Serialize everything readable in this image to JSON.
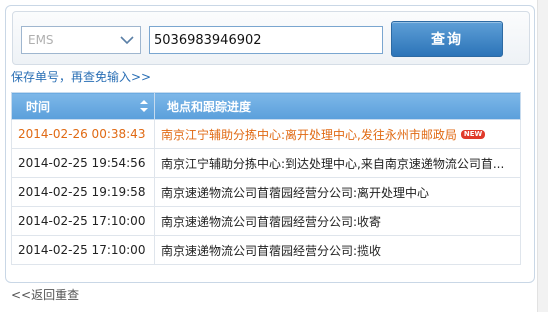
{
  "search": {
    "carrier_selected": "EMS",
    "tracking_number": "5036983946902",
    "query_label": "查询"
  },
  "save_link": "保存单号，再查免输入>>",
  "table": {
    "headers": {
      "time": "时间",
      "location": "地点和跟踪进度"
    },
    "rows": [
      {
        "time": "2014-02-26 00:38:43",
        "status": "南京江宁辅助分拣中心:离开处理中心,发往永州市邮政局",
        "latest": true,
        "badge": "NEW"
      },
      {
        "time": "2014-02-25 19:54:56",
        "status": "南京江宁辅助分拣中心:到达处理中心,来自南京速递物流公司苜...",
        "latest": false
      },
      {
        "time": "2014-02-25 19:19:58",
        "status": "南京速递物流公司苜蓿园经营分公司:离开处理中心",
        "latest": false
      },
      {
        "time": "2014-02-25 17:10:00",
        "status": "南京速递物流公司苜蓿园经营分公司:收寄",
        "latest": false
      },
      {
        "time": "2014-02-25 17:10:00",
        "status": "南京速递物流公司苜蓿园经营分公司:揽收",
        "latest": false
      }
    ]
  },
  "back_link": "<<返回重查",
  "colors": {
    "header_blue": "#5a9fdb",
    "link_blue": "#2a6fb5",
    "latest_orange": "#e06a14"
  }
}
